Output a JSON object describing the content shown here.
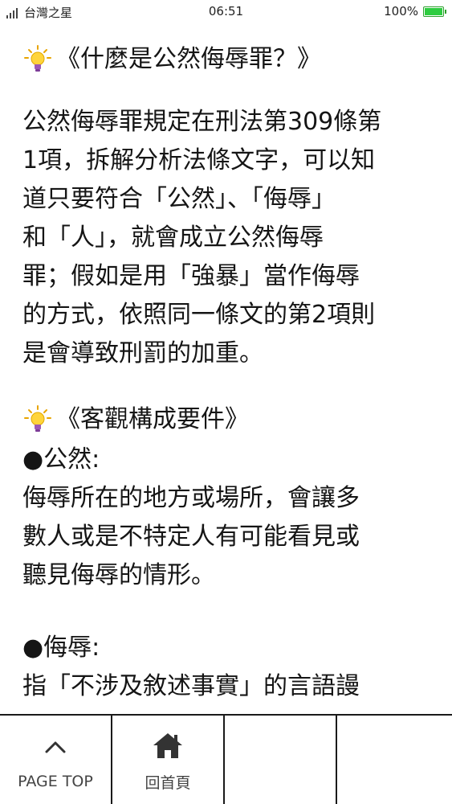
{
  "status_bar": {
    "carrier": "台灣之星",
    "time": "06:51",
    "battery_percent_label": "100%",
    "battery_level": 1.0,
    "signal_icon": "signal-icon",
    "battery_icon": "battery-charging-icon",
    "battery_color": "#2ecc40"
  },
  "content": {
    "section1": {
      "icon": "lightbulb-icon",
      "title": "《什麼是公然侮辱罪？》",
      "lines": [
        "公然侮辱罪規定在刑法第309條第",
        "1項，拆解分析法條文字，可以知",
        "道只要符合「公然」、「侮辱」",
        "和「人」，就會成立公然侮辱",
        "罪；假如是用「強暴」當作侮辱",
        "的方式，依照同一條文的第2項則",
        "是會導致刑罰的加重。"
      ]
    },
    "section2": {
      "icon": "lightbulb-icon",
      "title": "《客觀構成要件》",
      "item1": {
        "label": "●公然:",
        "lines": [
          "侮辱所在的地方或場所，會讓多",
          "數人或是不特定人有可能看見或",
          "聽見侮辱的情形。"
        ]
      },
      "item2": {
        "label": "●侮辱:",
        "lines": [
          "指「不涉及敘述事實」的言語謾"
        ]
      }
    }
  },
  "bottom_nav": {
    "page_top": {
      "icon": "chevron-up-icon",
      "label": "PAGE TOP"
    },
    "home": {
      "icon": "home-icon",
      "label": "回首頁"
    }
  }
}
